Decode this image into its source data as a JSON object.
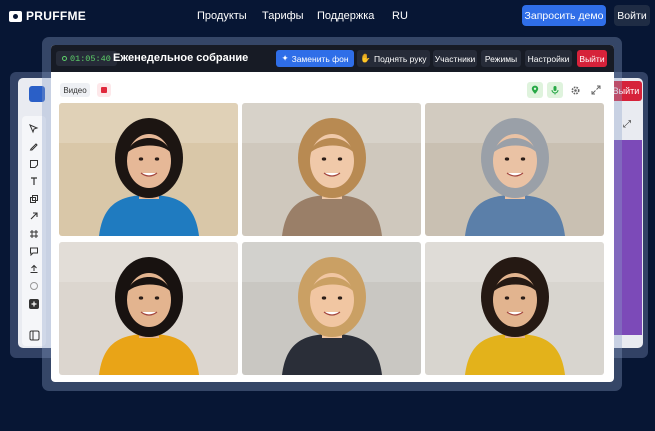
{
  "nav": {
    "logo": "PRUFFME",
    "links": [
      "Продукты",
      "Тарифы",
      "Поддержка",
      "RU"
    ],
    "demo_button": "Запросить демо",
    "login_button": "Войти"
  },
  "background_window": {
    "exit_button": "Выйти"
  },
  "meeting": {
    "timer": "01:05:40",
    "title": "Еженедельное собрание",
    "buttons": {
      "change_bg": "Заменить фон",
      "raise_hand": "Поднять руку",
      "participants": "Участники",
      "modes": "Режимы",
      "settings": "Настройки",
      "exit": "Выйти"
    },
    "video_tab": "Видео",
    "icons": [
      "location-icon",
      "mic-icon",
      "gear-icon",
      "expand-icon"
    ]
  },
  "participants": [
    {
      "name": "participant-1",
      "bg": "#d9c7a8",
      "skin": "#e6b897",
      "hair": "#1c1512",
      "shirt": "#1f7bc0"
    },
    {
      "name": "participant-2",
      "bg": "#cfc8bd",
      "skin": "#f0c9a9",
      "hair": "#b88a52",
      "shirt": "#9a7f68"
    },
    {
      "name": "participant-3",
      "bg": "#c9c0b2",
      "skin": "#eac2a4",
      "hair": "#9aa0a8",
      "shirt": "#5b7fa9"
    },
    {
      "name": "participant-4",
      "bg": "#dcd6cf",
      "skin": "#e3b48f",
      "hair": "#181210",
      "shirt": "#e9a417"
    },
    {
      "name": "participant-5",
      "bg": "#c9c7c2",
      "skin": "#f1c6a2",
      "hair": "#caa064",
      "shirt": "#2a2e38"
    },
    {
      "name": "participant-6",
      "bg": "#d8d5cf",
      "skin": "#e2b48f",
      "hair": "#251913",
      "shirt": "#e3b21b"
    }
  ],
  "colors": {
    "page_bg": "#071634",
    "accent": "#2f6ee8",
    "danger": "#d6223a",
    "timer_green": "#5ed16a"
  }
}
